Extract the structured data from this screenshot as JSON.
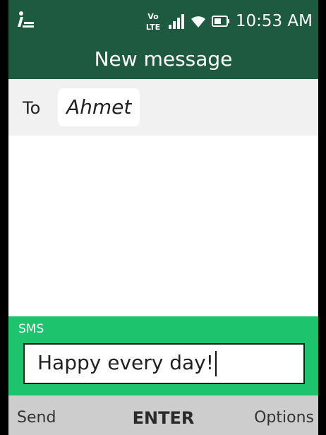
{
  "status_bar": {
    "time": "10:53 AM",
    "network": "LTE",
    "icons": [
      "notification-icon",
      "volte-lte-icon",
      "signal-icon",
      "wifi-icon",
      "battery-icon"
    ]
  },
  "header": {
    "title": "New message"
  },
  "recipient": {
    "label": "To",
    "name": "Ahmet"
  },
  "composer": {
    "type_label": "SMS",
    "text": "Happy every day!"
  },
  "softkeys": {
    "left": "Send",
    "center": "ENTER",
    "right": "Options"
  },
  "colors": {
    "header_bg": "#1d5a3f",
    "composer_bg": "#1ec46d",
    "softkey_bg": "#cdcdcd",
    "to_row_bg": "#f1f1f1"
  }
}
